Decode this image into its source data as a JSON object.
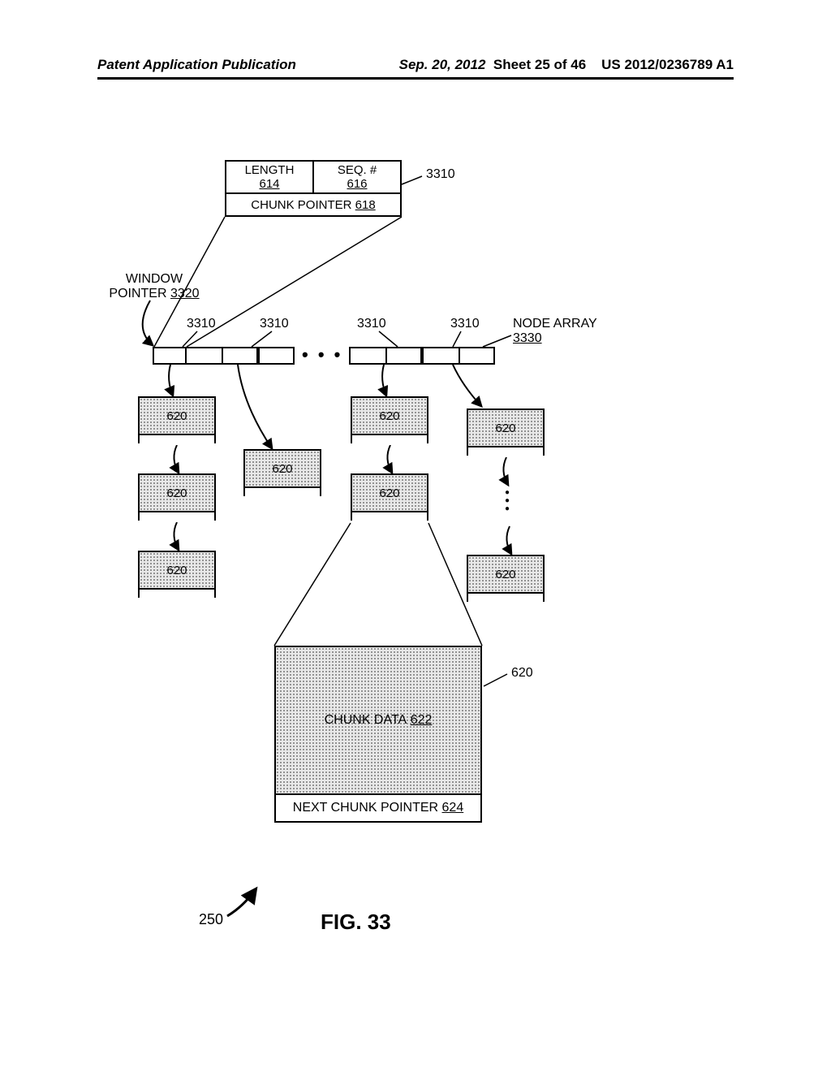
{
  "header": {
    "left": "Patent Application Publication",
    "date": "Sep. 20, 2012",
    "sheet": "Sheet 25 of 46",
    "pubno": "US 2012/0236789 A1"
  },
  "headerbox": {
    "length_label": "LENGTH",
    "length_ref": "614",
    "seq_label": "SEQ. #",
    "seq_ref": "616",
    "chunk_ptr_label": "CHUNK POINTER",
    "chunk_ptr_ref": "618",
    "callout": "3310"
  },
  "window_ptr": {
    "label": "WINDOW POINTER",
    "ref": "3320"
  },
  "node_array": {
    "label": "NODE ARRAY",
    "ref": "3330"
  },
  "array_callouts": {
    "a": "3310",
    "b": "3310",
    "c": "3310",
    "d": "3310"
  },
  "chunk_label": "620",
  "chunkdata": {
    "callout": "620",
    "data_label": "CHUNK DATA",
    "data_ref": "622",
    "next_label": "NEXT CHUNK POINTER",
    "next_ref": "624"
  },
  "figure": {
    "ref250": "250",
    "title": "FIG. 33"
  }
}
